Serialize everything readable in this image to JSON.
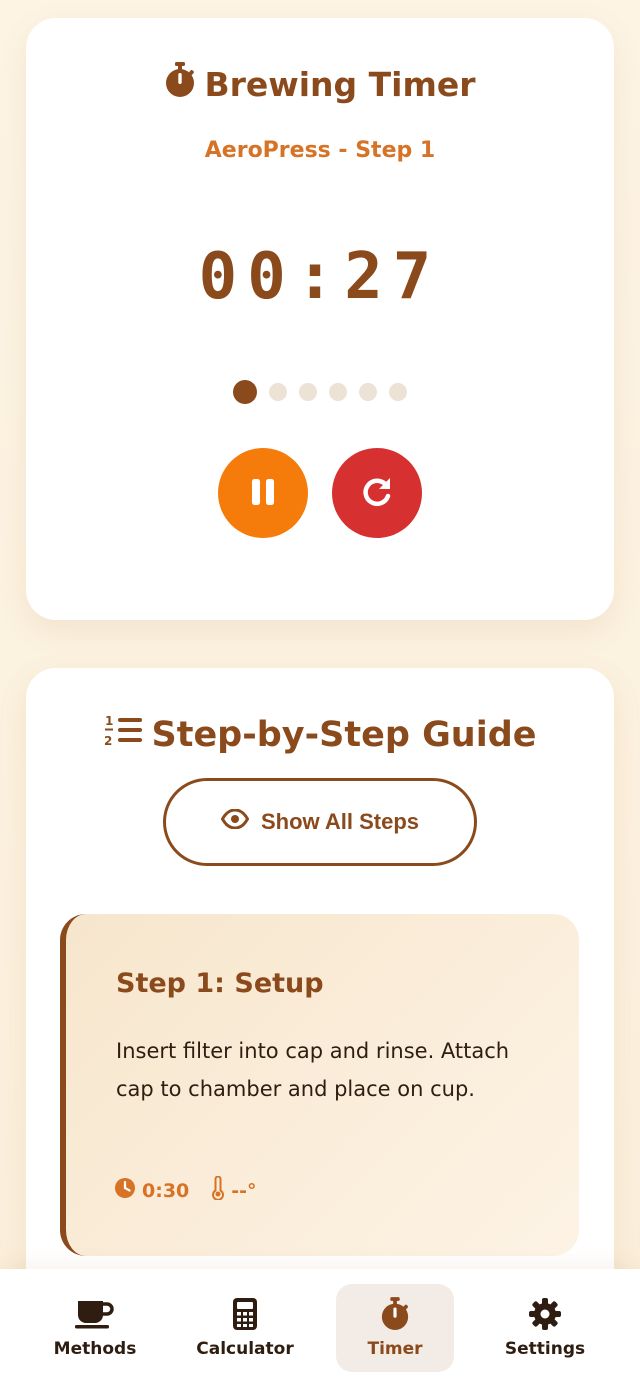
{
  "timer": {
    "title": "Brewing Timer",
    "subtitle": "AeroPress - Step 1",
    "time": "00:27",
    "total_steps": 6,
    "current_step_index": 0,
    "pause_icon": "pause-icon",
    "reset_icon": "redo-icon"
  },
  "guide": {
    "title": "Step-by-Step Guide",
    "show_all_label": "Show All Steps",
    "step": {
      "title": "Step 1: Setup",
      "description": "Insert filter into cap and rinse. Attach cap to chamber and place on cup.",
      "duration": "0:30",
      "temperature": "--°"
    }
  },
  "nav": {
    "items": [
      {
        "label": "Methods",
        "icon": "coffee-mug-icon"
      },
      {
        "label": "Calculator",
        "icon": "calculator-icon"
      },
      {
        "label": "Timer",
        "icon": "stopwatch-icon"
      },
      {
        "label": "Settings",
        "icon": "gear-icon"
      }
    ],
    "active": "Timer"
  },
  "colors": {
    "brand_brown": "#8a4a1c",
    "accent_orange": "#d67326",
    "pause_button": "#f57c0a",
    "reset_button": "#d63030",
    "inactive_dot": "#ece2d6"
  }
}
